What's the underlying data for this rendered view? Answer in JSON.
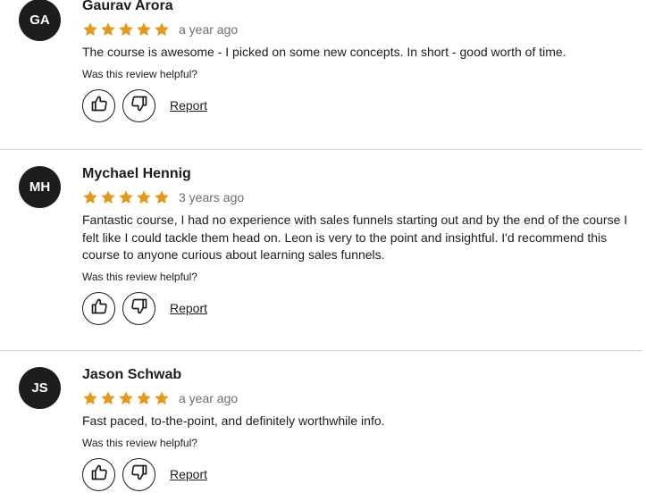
{
  "reviews": [
    {
      "initials": "GA",
      "name": "Gaurav Arora",
      "rating": 5,
      "time": "a year ago",
      "text": "The course is awesome - I picked on some new concepts. In short - good worth of time.",
      "helpful_question": "Was this review helpful?",
      "report_label": "Report"
    },
    {
      "initials": "MH",
      "name": "Mychael Hennig",
      "rating": 5,
      "time": "3 years ago",
      "text": "Fantastic course, I had no experience with sales funnels starting out and by the end of the course I felt like I could tackle them head on. Leon is very to the point and insightful. I'd recommend this course to anyone curious about learning sales funnels.",
      "helpful_question": "Was this review helpful?",
      "report_label": "Report"
    },
    {
      "initials": "JS",
      "name": "Jason Schwab",
      "rating": 5,
      "time": "a year ago",
      "text": "Fast paced, to-the-point, and definitely worthwhile info.",
      "helpful_question": "Was this review helpful?",
      "report_label": "Report"
    }
  ],
  "colors": {
    "star": "#e59819",
    "avatar_bg": "#1c1d1f",
    "divider": "#d1d7dc"
  },
  "icons": {
    "star": "star-icon",
    "like": "thumbs-up-icon",
    "dislike": "thumbs-down-icon"
  }
}
